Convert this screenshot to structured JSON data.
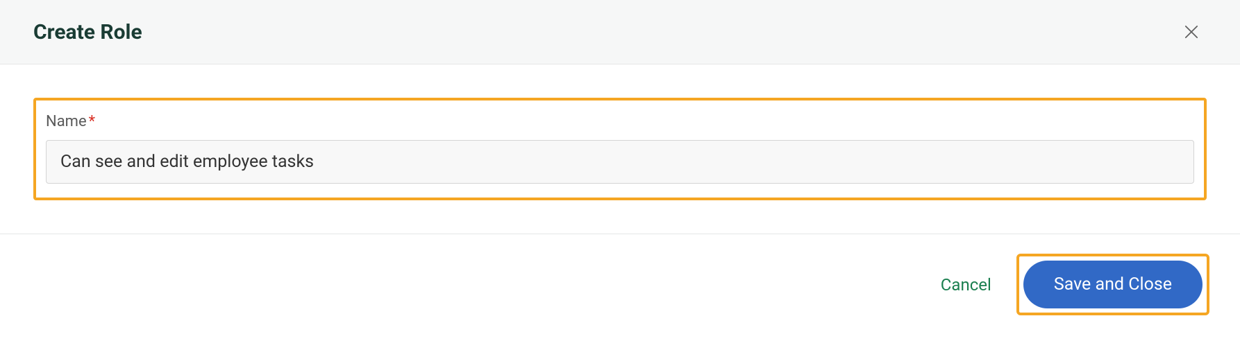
{
  "header": {
    "title": "Create Role"
  },
  "form": {
    "name_label": "Name",
    "required_indicator": "*",
    "name_value": "Can see and edit employee tasks"
  },
  "footer": {
    "cancel_label": "Cancel",
    "save_label": "Save and Close"
  }
}
